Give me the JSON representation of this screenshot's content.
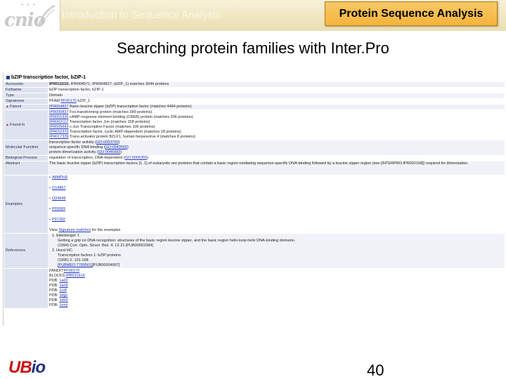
{
  "header": {
    "logo_text": "cnio",
    "logo_dots": "• • •",
    "course": "Introduction to Sequence Analysis",
    "title_badge": "Protein Sequence Analysis"
  },
  "slide_title": "Searching protein families with Inter.Pro",
  "entry": {
    "title": "bZIP transcription factor, bZIP-1",
    "accession_label": "Accession",
    "accession_main": "IPR011616;",
    "accession_rest": "IPR004571; IPR004827; (bZIP_1) matches 3044 proteins",
    "fullname_label": "Fullname",
    "fullname": "bZIP transcription factor, bZIP-1",
    "type_label": "Type",
    "type": "Domain",
    "signatures_label": "Signatures",
    "signature_db": "PFAM",
    "signature_id": "PF00170",
    "signature_name": "bZIP_1",
    "parent_label": "Parent",
    "parent_id": "IPR004827",
    "parent_desc": "Basic-leucine zipper (bZIP) transcription factor (matches 4484 proteins)",
    "found_in_label": "Found in",
    "found_in": [
      {
        "id": "IPR000837",
        "desc": "Fos transforming protein (matches 289 proteins)"
      },
      {
        "id": "IPR001630",
        "desc": "cAMP response element binding (CREB) protein (matches 206 proteins)"
      },
      {
        "id": "IPR002112",
        "desc": "Transcription factor Jun (matches 158 proteins)"
      },
      {
        "id": "IPR005643",
        "desc": "c-Jun Transcription Factor (matches 106 proteins)"
      },
      {
        "id": "IPR010376",
        "desc": "Transcription factor, cyclic AMP-dependent (matches 18 proteins)"
      },
      {
        "id": "IPR017339",
        "desc": "Trans-activator protein BZLF1, human herpesvirus 4 (matches 8 proteins)"
      }
    ],
    "molfunc_label": "Molecular Function",
    "molfunc": [
      {
        "text": "transcription factor activity",
        "id": "GO:0003700"
      },
      {
        "text": "sequence-specific DNA binding",
        "id": "GO:0043565"
      },
      {
        "text": "protein dimerization activity",
        "id": "GO:0046983"
      }
    ],
    "bioproc_label": "Biological Process",
    "bioproc": {
      "text": "regulation of transcription, DNA-dependent",
      "id": "GO:0006355"
    },
    "abstract_label": "Abstract",
    "abstract": "The basic-leucine zipper (bZIP) transcription factors [1, 1] of eukaryotic are proteins that contain a basic region mediating sequence-specific DNA-binding followed by a leucine zipper region (see [INTERPRO:IPR002158]) required for dimerisation.",
    "examples_label": "Examples",
    "examples": [
      "A8MPH9",
      "O14867",
      "O24646",
      "P03069",
      "P97302"
    ],
    "examples_footer_pre": "View",
    "examples_footer_link": "Signature matches",
    "examples_footer_post": "for the examples",
    "references_label": "References",
    "ref1_author": "1. Ellenberger T.",
    "ref1_title": "Getting a grip on DNA recognition: structures of the basic region leucine zipper, and the basic region helix-loop-helix DNA-binding domains.",
    "ref1_cite": "(1994) Curr. Opin. Struct. Biol. 4: 12-21 [PUB00001084]",
    "ref2_author": "2. Hurst HC.",
    "ref2_title": "Transcription factors 1: bZIP proteins",
    "ref2_cite": "(1995) 2: 101-168",
    "ref2_pub_link": "[PUBMED:7789561]",
    "ref2_pub_rest": "[PUB00004967]",
    "xrefs": [
      {
        "db": "PANDIT:",
        "id": "PF00170"
      },
      {
        "db": "BLOCKS:",
        "id": "IPB011616"
      },
      {
        "db": "PDB:",
        "id": "1a02"
      },
      {
        "db": "PDB:",
        "id": "1an9"
      },
      {
        "db": "PDB:",
        "id": "1cI8"
      },
      {
        "db": "PDB:",
        "id": "1dgc"
      },
      {
        "db": "PDB:",
        "id": "1dh3"
      },
      {
        "db": "PDB:",
        "id": "1eny"
      }
    ]
  },
  "footer": {
    "logo_ub": "UB",
    "logo_io": "io",
    "page_number": "40"
  },
  "colors": {
    "header_band": "#efe6bf",
    "badge": "#f5b43c",
    "label_cell": "#dfe3ef",
    "link": "#1830b8",
    "ubio_red": "#c81414",
    "ubio_blue": "#1e2f80"
  }
}
